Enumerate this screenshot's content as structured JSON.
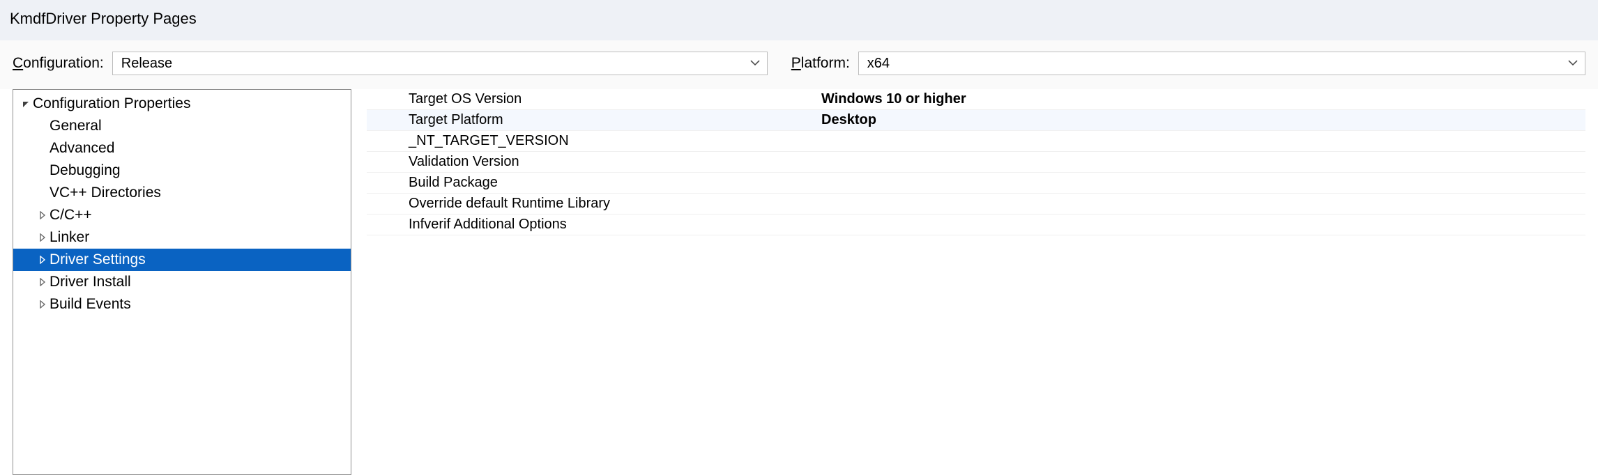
{
  "title": "KmdfDriver Property Pages",
  "config": {
    "configurationLabelPre": "C",
    "configurationLabelRest": "onfiguration:",
    "configurationValue": "Release",
    "platformLabelPre": "P",
    "platformLabelRest": "latform:",
    "platformValue": "x64"
  },
  "tree": {
    "root": "Configuration Properties",
    "items": [
      {
        "label": "General",
        "arrow": "none",
        "selected": false
      },
      {
        "label": "Advanced",
        "arrow": "none",
        "selected": false
      },
      {
        "label": "Debugging",
        "arrow": "none",
        "selected": false
      },
      {
        "label": "VC++ Directories",
        "arrow": "none",
        "selected": false
      },
      {
        "label": "C/C++",
        "arrow": "collapsed",
        "selected": false
      },
      {
        "label": "Linker",
        "arrow": "collapsed",
        "selected": false
      },
      {
        "label": "Driver Settings",
        "arrow": "collapsed",
        "selected": true
      },
      {
        "label": "Driver Install",
        "arrow": "collapsed",
        "selected": false
      },
      {
        "label": "Build Events",
        "arrow": "collapsed",
        "selected": false
      }
    ]
  },
  "props": [
    {
      "name": "Target OS Version",
      "value": "Windows 10 or higher",
      "highlight": false
    },
    {
      "name": "Target Platform",
      "value": "Desktop",
      "highlight": true
    },
    {
      "name": "_NT_TARGET_VERSION",
      "value": "",
      "highlight": false
    },
    {
      "name": "Validation Version",
      "value": "",
      "highlight": false
    },
    {
      "name": "Build Package",
      "value": "",
      "highlight": false
    },
    {
      "name": "Override default Runtime Library",
      "value": "",
      "highlight": false
    },
    {
      "name": "Infverif Additional Options",
      "value": "",
      "highlight": false
    }
  ]
}
